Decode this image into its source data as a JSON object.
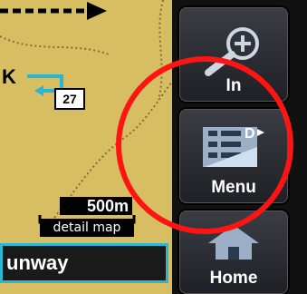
{
  "map": {
    "route_number": "27",
    "scale_value": "500m",
    "scale_label": "detail map"
  },
  "status_bar": {
    "runway_text": "unway"
  },
  "sidebar": {
    "zoom_in_label": "In",
    "menu_label": "Menu",
    "home_label": "Home"
  },
  "colors": {
    "map_background": "#d8be62",
    "highlight_circle": "#ff1414",
    "route_blue": "#2ab7d6"
  },
  "icons": [
    "zoom-in-magnifier-icon",
    "menu-list-icon",
    "home-icon",
    "direction-arrow-icon"
  ]
}
